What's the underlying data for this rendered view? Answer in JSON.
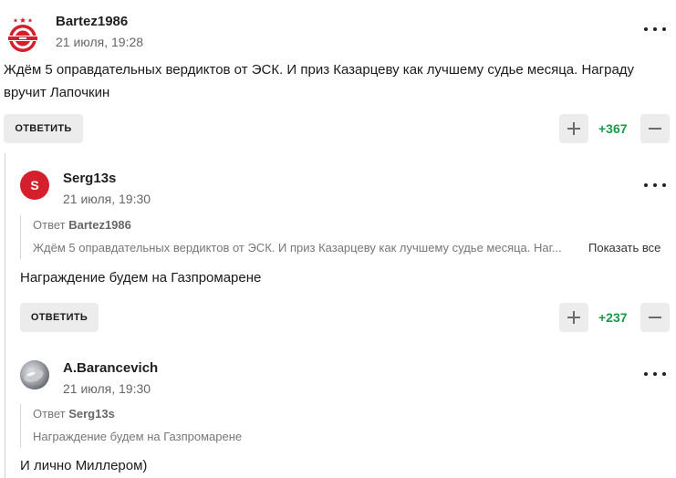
{
  "comments": [
    {
      "username": "Bartez1986",
      "date": "21 июля, 19:28",
      "avatar_icon": "spartak-logo-icon",
      "text": "Ждём 5 оправдательных вердиктов от ЭСК. И приз Казарцеву как лучшему судье месяца. Награду вручит Лапочкин",
      "reply_label": "ОТВЕТИТЬ",
      "score": "+367"
    },
    {
      "username": "Serg13s",
      "date": "21 июля, 19:30",
      "avatar_letter": "S",
      "avatar_color": "#d61f2c",
      "quote": {
        "prefix": "Ответ",
        "author": "Bartez1986",
        "text": "Ждём 5 оправдательных вердиктов от ЭСК. И приз Казарцеву как лучшему судье месяца. Наг...",
        "show_all": "Показать все"
      },
      "text": "Награждение будем на Газпромарене",
      "reply_label": "ОТВЕТИТЬ",
      "score": "+237"
    },
    {
      "username": "A.Barancevich",
      "date": "21 июля, 19:30",
      "avatar_icon": "photo-avatar-icon",
      "quote": {
        "prefix": "Ответ",
        "author": "Serg13s",
        "text": "Награждение будем на Газпромарене"
      },
      "text": "И лично Миллером)"
    }
  ],
  "colors": {
    "score": "#1a9a4a",
    "button_bg": "#ececec",
    "brand_red": "#d61f2c"
  }
}
